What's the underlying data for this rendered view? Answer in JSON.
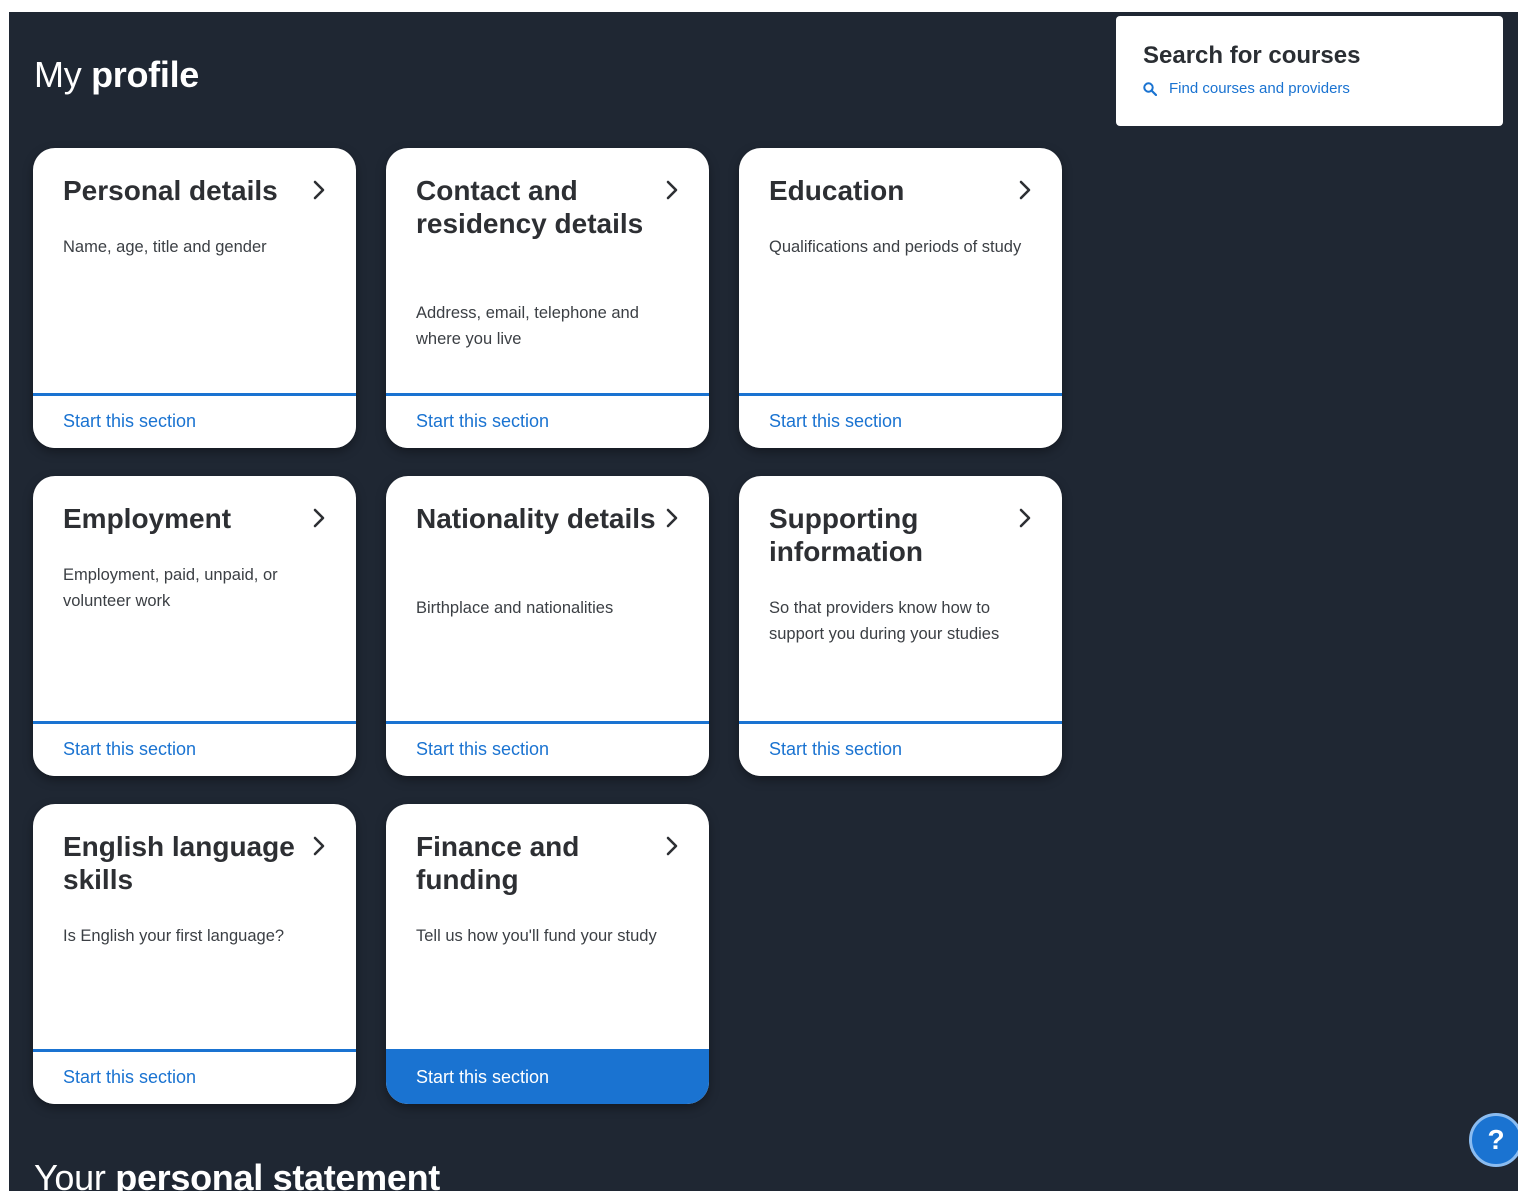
{
  "header": {
    "title_prefix": "My",
    "title_bold": "profile"
  },
  "search": {
    "title": "Search for courses",
    "link_label": "Find courses and providers",
    "icon": "search-icon"
  },
  "cards": [
    {
      "title": "Personal details",
      "description": "Name, age, title and gender",
      "action": "Start this section",
      "active": false
    },
    {
      "title": "Contact and residency details",
      "description": "Address, email, telephone and where you live",
      "action": "Start this section",
      "active": false
    },
    {
      "title": "Education",
      "description": "Qualifications and periods of study",
      "action": "Start this section",
      "active": false
    },
    {
      "title": "Employment",
      "description": "Employment, paid, unpaid, or volunteer work",
      "action": "Start this section",
      "active": false
    },
    {
      "title": "Nationality details",
      "description": "Birthplace and nationalities",
      "action": "Start this section",
      "active": false
    },
    {
      "title": "Supporting information",
      "description": "So that providers know how to support you during your studies",
      "action": "Start this section",
      "active": false
    },
    {
      "title": "English language skills",
      "description": "Is English your first language?",
      "action": "Start this section",
      "active": false
    },
    {
      "title": "Finance and funding",
      "description": "Tell us how you'll fund your study",
      "action": "Start this section",
      "active": true
    }
  ],
  "statement": {
    "title_prefix": "Your",
    "title_bold": "personal statement"
  },
  "help": {
    "label": "?",
    "icon": "help-icon"
  },
  "colors": {
    "background": "#1f2733",
    "accent": "#1a73d1",
    "card": "#ffffff"
  }
}
